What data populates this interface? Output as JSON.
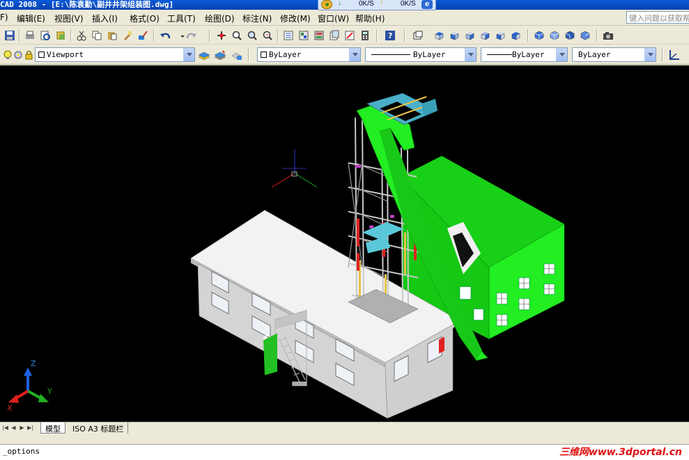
{
  "window": {
    "title": "CAD 2008 - [E:\\陈袁勤\\副井井架组装图.dwg]"
  },
  "net_meter": {
    "down_value": "0K/S",
    "up_value": "0K/S",
    "ie_label": "e"
  },
  "menu": {
    "items": [
      "F)",
      "编辑(E)",
      "视图(V)",
      "插入(I)",
      "格式(O)",
      "工具(T)",
      "绘图(D)",
      "标注(N)",
      "修改(M)",
      "窗口(W)",
      "帮助(H)"
    ],
    "help_placeholder": "键入问题以获取帮助"
  },
  "toolbar": {
    "icons": [
      "save-icon",
      "plot-icon",
      "plot-preview-icon",
      "publish-icon",
      "cut-icon",
      "copy-icon",
      "paste-icon",
      "match-properties-icon",
      "block-editor-icon",
      "undo-icon",
      "redo-icon",
      "pan-icon",
      "zoom-realtime-icon",
      "zoom-window-icon",
      "zoom-previous-icon",
      "properties-icon",
      "design-center-icon",
      "tool-palettes-icon",
      "sheet-set-icon",
      "markup-icon",
      "calculator-icon",
      "help-icon",
      "named-views-icon",
      "top-view-icon",
      "bottom-view-icon",
      "left-view-icon",
      "right-view-icon",
      "front-view-icon",
      "back-view-icon",
      "sw-iso-icon",
      "se-iso-icon",
      "ne-iso-icon",
      "nw-iso-icon",
      "camera-icon"
    ]
  },
  "layers": {
    "current_layer": "Viewport",
    "color": "ByLayer",
    "linetype": "ByLayer",
    "lineweight": "ByLayer",
    "plot_style": "ByLayer"
  },
  "ucs": {
    "x_label": "X",
    "y_label": "Y",
    "z_label": "Z"
  },
  "layout_tabs": [
    {
      "label": "模型",
      "active": true
    },
    {
      "label": "ISO A3 标题栏",
      "active": false
    }
  ],
  "command": {
    "text": "_options"
  },
  "watermark": {
    "text": "三维网www.3dportal.cn"
  },
  "colors": {
    "model_green": "#22ee22",
    "building_gray": "#d8d8d8",
    "viewport_bg": "#000000"
  }
}
